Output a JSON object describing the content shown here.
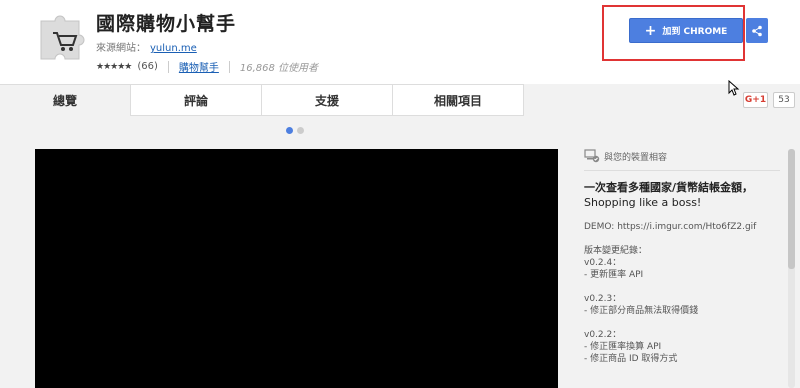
{
  "header": {
    "title": "國際購物小幫手",
    "source_label": "來源網站：",
    "source_link": "yulun.me",
    "stars": "★★★★★",
    "rating_count": "(66)",
    "category": "購物幫手",
    "users": "16,868 位使用者",
    "add_button_label": "加到 CHROME"
  },
  "tabs": [
    {
      "label": "總覽",
      "active": true
    },
    {
      "label": "評論",
      "active": false
    },
    {
      "label": "支援",
      "active": false
    },
    {
      "label": "相關項目",
      "active": false
    }
  ],
  "social": {
    "gplus_label": "G+1",
    "gplus_count": "53"
  },
  "panel": {
    "compat_text": "與您的裝置相容",
    "desc_title": "一次查看多種國家/貨幣結帳金額，",
    "desc_sub": "Shopping like a boss!",
    "demo": "DEMO: https://i.imgur.com/Hto6fZ2.gif",
    "changelog": "版本變更紀錄：\nv0.2.4：\n- 更新匯率 API\n\nv0.2.3：\n- 修正部分商品無法取得價錢\n\nv0.2.2：\n- 修正匯率換算 API\n- 修正商品 ID 取得方式"
  },
  "colors": {
    "accent": "#4d7fe0",
    "highlight_box": "#e03434"
  },
  "icons": [
    "puzzle-cart-icon",
    "plus-icon",
    "share-icon",
    "cursor-icon",
    "compat-icon"
  ]
}
